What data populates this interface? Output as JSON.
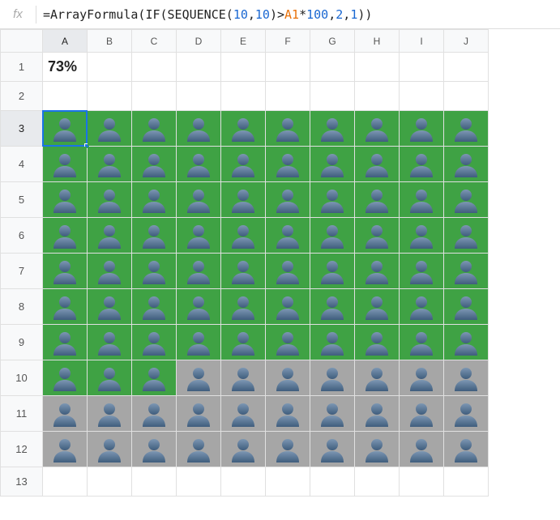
{
  "formula_bar": {
    "fx": "fx",
    "tokens": [
      {
        "t": "=",
        "c": "punc"
      },
      {
        "t": "ArrayFormula",
        "c": "fn"
      },
      {
        "t": "(",
        "c": "punc"
      },
      {
        "t": "IF",
        "c": "fn"
      },
      {
        "t": "(",
        "c": "punc"
      },
      {
        "t": "SEQUENCE",
        "c": "fn"
      },
      {
        "t": "(",
        "c": "punc"
      },
      {
        "t": "10",
        "c": "num"
      },
      {
        "t": ",",
        "c": "punc"
      },
      {
        "t": "10",
        "c": "num"
      },
      {
        "t": ")>",
        "c": "punc"
      },
      {
        "t": "A1",
        "c": "cellref"
      },
      {
        "t": "*",
        "c": "punc"
      },
      {
        "t": "100",
        "c": "num"
      },
      {
        "t": ",",
        "c": "punc"
      },
      {
        "t": "2",
        "c": "num"
      },
      {
        "t": ",",
        "c": "punc"
      },
      {
        "t": "1",
        "c": "num"
      },
      {
        "t": "))",
        "c": "punc"
      }
    ],
    "formula_plain": "=ArrayFormula(IF(SEQUENCE(10,10)>A1*100,2,1))"
  },
  "columns": [
    "A",
    "B",
    "C",
    "D",
    "E",
    "F",
    "G",
    "H",
    "I",
    "J"
  ],
  "rows": [
    "1",
    "2",
    "3",
    "4",
    "5",
    "6",
    "7",
    "8",
    "9",
    "10",
    "11",
    "12",
    "13"
  ],
  "cells": {
    "A1": "73%"
  },
  "icon_colors": {
    "green": "#3fa244",
    "grey": "#a6a6a6",
    "person_fill_top": "#7d97b3",
    "person_fill_bottom": "#3f5d7d"
  },
  "selection": {
    "cell": "A3",
    "col": "A",
    "row": "3"
  },
  "chart_data": {
    "type": "table",
    "description": "10x10 person pictogram. Green = first group, Grey = second group.",
    "rows_region": [
      "3",
      "4",
      "5",
      "6",
      "7",
      "8",
      "9",
      "10",
      "11",
      "12"
    ],
    "cols_region": [
      "A",
      "B",
      "C",
      "D",
      "E",
      "F",
      "G",
      "H",
      "I",
      "J"
    ],
    "threshold_percent": 73,
    "grid": [
      [
        "green",
        "green",
        "green",
        "green",
        "green",
        "green",
        "green",
        "green",
        "green",
        "green"
      ],
      [
        "green",
        "green",
        "green",
        "green",
        "green",
        "green",
        "green",
        "green",
        "green",
        "green"
      ],
      [
        "green",
        "green",
        "green",
        "green",
        "green",
        "green",
        "green",
        "green",
        "green",
        "green"
      ],
      [
        "green",
        "green",
        "green",
        "green",
        "green",
        "green",
        "green",
        "green",
        "green",
        "green"
      ],
      [
        "green",
        "green",
        "green",
        "green",
        "green",
        "green",
        "green",
        "green",
        "green",
        "green"
      ],
      [
        "green",
        "green",
        "green",
        "green",
        "green",
        "green",
        "green",
        "green",
        "green",
        "green"
      ],
      [
        "green",
        "green",
        "green",
        "green",
        "green",
        "green",
        "green",
        "green",
        "green",
        "green"
      ],
      [
        "green",
        "green",
        "green",
        "grey",
        "grey",
        "grey",
        "grey",
        "grey",
        "grey",
        "grey"
      ],
      [
        "grey",
        "grey",
        "grey",
        "grey",
        "grey",
        "grey",
        "grey",
        "grey",
        "grey",
        "grey"
      ],
      [
        "grey",
        "grey",
        "grey",
        "grey",
        "grey",
        "grey",
        "grey",
        "grey",
        "grey",
        "grey"
      ]
    ]
  }
}
